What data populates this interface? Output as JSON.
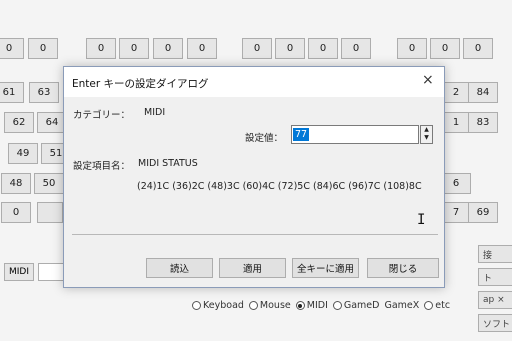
{
  "background": {
    "keys": [
      {
        "text": "0"
      },
      {
        "text": "0"
      },
      {
        "text": "0"
      },
      {
        "text": "0"
      },
      {
        "text": "0"
      },
      {
        "text": "0"
      },
      {
        "text": "0"
      },
      {
        "text": "0"
      },
      {
        "text": "0"
      },
      {
        "text": "0"
      },
      {
        "text": "0"
      },
      {
        "text": "0"
      },
      {
        "text": "0"
      },
      {
        "text": "61"
      },
      {
        "text": "63"
      },
      {
        "text": "62"
      },
      {
        "text": "64"
      },
      {
        "text": "49"
      },
      {
        "text": "51"
      },
      {
        "text": "48"
      },
      {
        "text": "50"
      },
      {
        "text": "0"
      },
      {
        "text": "2"
      },
      {
        "text": "84"
      },
      {
        "text": "1"
      },
      {
        "text": "83"
      },
      {
        "text": "6"
      },
      {
        "text": "7"
      },
      {
        "text": "69"
      }
    ],
    "midi_label": "MIDI",
    "right_buttons": [
      "接",
      "ト",
      "ap ×",
      "ソフト"
    ],
    "radios": [
      {
        "label": "Keyboad",
        "selected": false
      },
      {
        "label": "Mouse",
        "selected": false
      },
      {
        "label": "MIDI",
        "selected": true
      },
      {
        "label": "GameD",
        "selected": false
      },
      {
        "label": "GameX",
        "selected": false
      },
      {
        "label": "etc",
        "selected": false
      }
    ]
  },
  "dialog": {
    "title": "Enter キーの設定ダイアログ",
    "close_icon": "×",
    "category_label": "カテゴリー：",
    "category_value": "MIDI",
    "setting_value_label": "設定値：",
    "setting_value": "77",
    "setting_item_label": "設定項目名：",
    "setting_item_value": "MIDI STATUS",
    "mapping_text": "(24)1C (36)2C (48)3C (60)4C (72)5C (84)6C (96)7C (108)8C",
    "buttons": {
      "read": "読込",
      "apply": "適用",
      "apply_all": "全キーに適用",
      "close": "閉じる"
    }
  }
}
